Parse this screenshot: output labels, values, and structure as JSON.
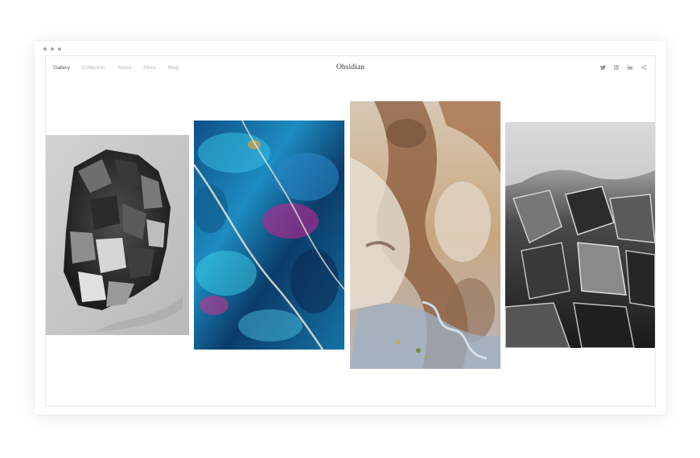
{
  "window": {
    "chrome": "browser-dots"
  },
  "nav": {
    "items": [
      {
        "label": "Gallery",
        "active": true
      },
      {
        "label": "Collection",
        "active": false
      },
      {
        "label": "About",
        "active": false
      },
      {
        "label": "Store",
        "active": false
      },
      {
        "label": "Blog",
        "active": false
      }
    ]
  },
  "brand": {
    "title": "Obsidian"
  },
  "social": {
    "icons": [
      "twitter-icon",
      "instagram-icon",
      "linkedin-icon",
      "share-icon"
    ],
    "color": "#8a8a8a"
  },
  "gallery": {
    "images": [
      {
        "subject": "grayscale crystal cluster",
        "palette": [
          "#2a2a2a",
          "#8a8a8a",
          "#d8d8d8"
        ]
      },
      {
        "subject": "iridescent blue mineral",
        "palette": [
          "#0c3c6e",
          "#2aa6d6",
          "#b0298f"
        ]
      },
      {
        "subject": "aerial desert landscape",
        "palette": [
          "#c8a77e",
          "#7a5034",
          "#9fb3c6"
        ]
      },
      {
        "subject": "grayscale fractured ice",
        "palette": [
          "#1e1e1e",
          "#777777",
          "#e2e2e2"
        ]
      }
    ]
  }
}
